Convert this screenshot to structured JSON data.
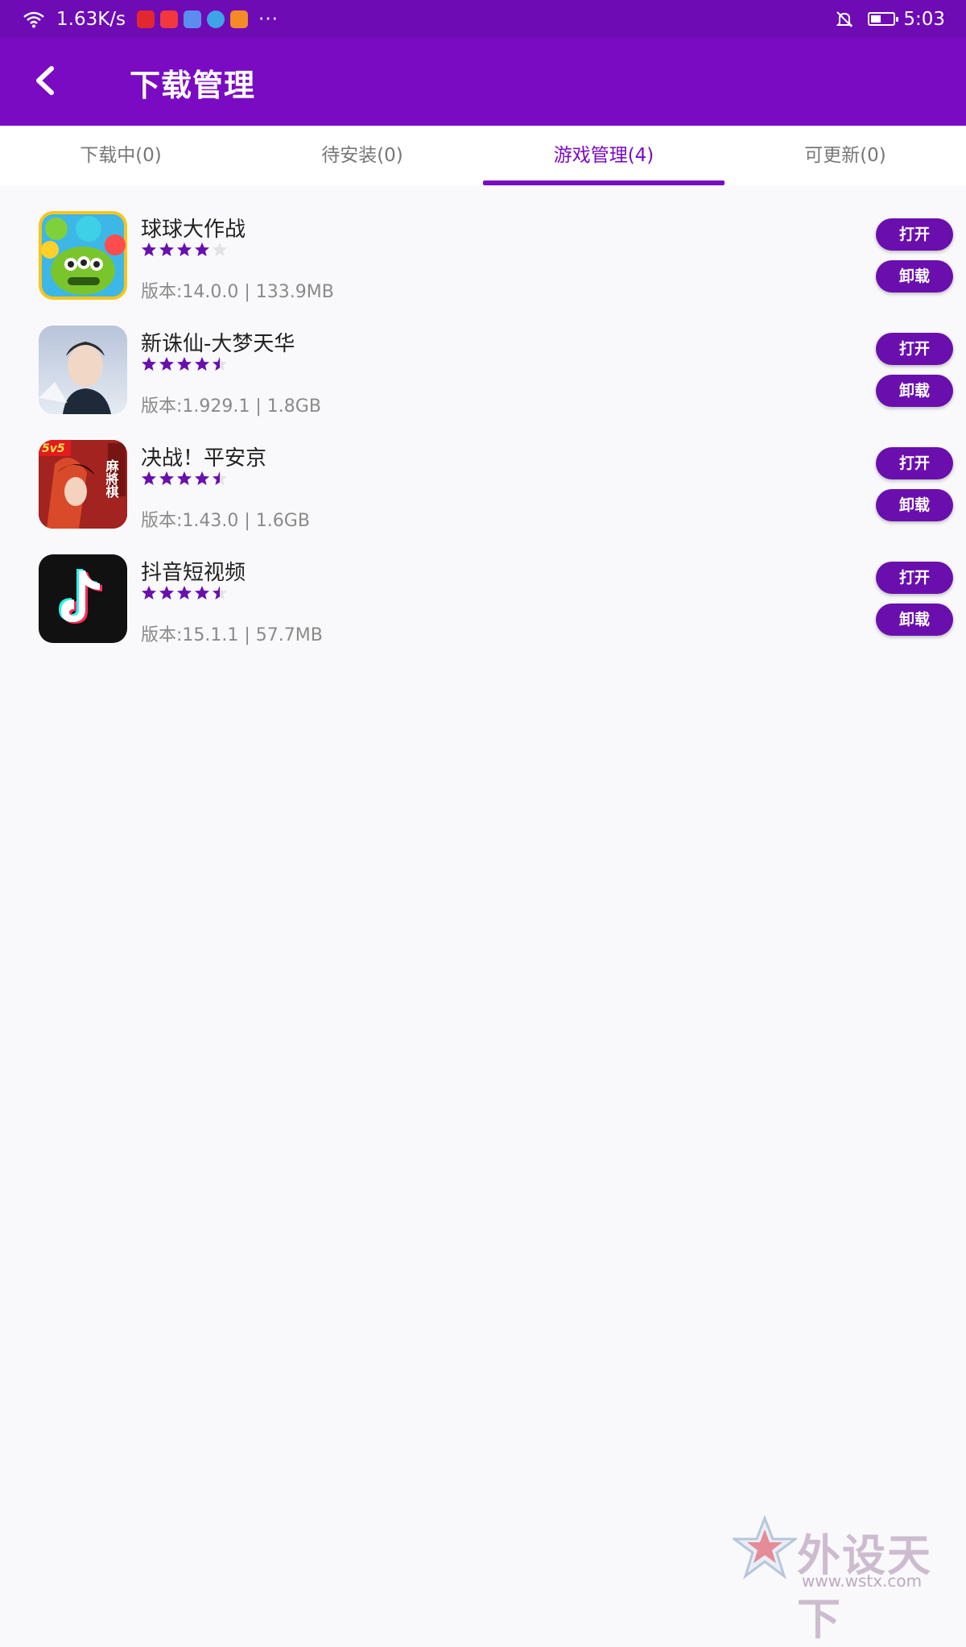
{
  "status_bar": {
    "speed": "1.63K/s",
    "more": "···",
    "time": "5:03",
    "battery_level": 0.45,
    "app_icons": [
      "weibo-eye-icon",
      "red-book-icon",
      "music-icon",
      "browser-icon",
      "play-icon"
    ]
  },
  "header": {
    "title": "下载管理"
  },
  "tabs": [
    {
      "label": "下载中(0)"
    },
    {
      "label": "待安装(0)"
    },
    {
      "label": "游戏管理(4)",
      "active": true
    },
    {
      "label": "可更新(0)"
    }
  ],
  "apps": [
    {
      "name": "球球大作战",
      "rating": 4.0,
      "info": "版本:14.0.0 | 133.9MB",
      "open_label": "打开",
      "uninstall_label": "卸载",
      "icon": "ball-game-icon"
    },
    {
      "name": "新诛仙-大梦天华",
      "rating": 4.5,
      "info": "版本:1.929.1 | 1.8GB",
      "open_label": "打开",
      "uninstall_label": "卸载",
      "icon": "portrait-game-icon"
    },
    {
      "name": "决战！平安京",
      "rating": 4.5,
      "info": "版本:1.43.0 | 1.6GB",
      "open_label": "打开",
      "uninstall_label": "卸载",
      "icon": "heian-game-icon",
      "icon_badge": "5v5",
      "icon_text": "麻將棋"
    },
    {
      "name": "抖音短视频",
      "rating": 4.5,
      "info": "版本:15.1.1 | 57.7MB",
      "open_label": "打开",
      "uninstall_label": "卸载",
      "icon": "douyin-icon"
    }
  ],
  "watermark": {
    "text": "外设天下",
    "url": "www.wstx.com"
  },
  "colors": {
    "primary": "#7a0bc2",
    "status_bar": "#6e0bb5",
    "button": "#6a0fae",
    "star": "#6a0fae"
  }
}
